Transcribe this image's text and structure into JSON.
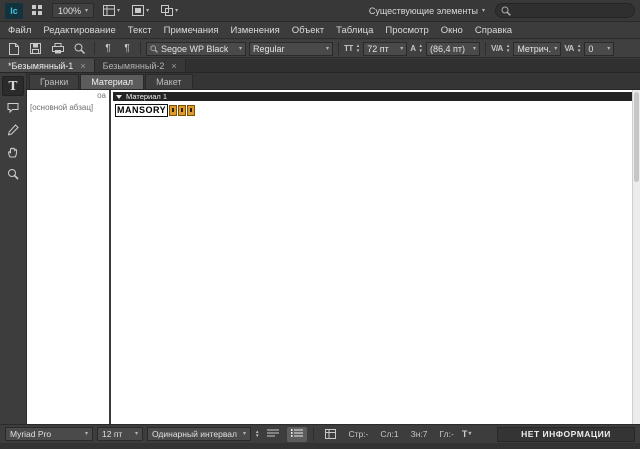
{
  "glyphs": {
    "caret": "▾",
    "close": "×",
    "pilcrow": "¶",
    "stepper_up": "▲",
    "stepper_down": "▼"
  },
  "app_bar": {
    "logo": "Ic",
    "zoom": "100%",
    "workspace": "Существующие элементы",
    "search_placeholder": ""
  },
  "menu_bar": {
    "items": [
      {
        "label": "Файл"
      },
      {
        "label": "Редактирование"
      },
      {
        "label": "Текст"
      },
      {
        "label": "Примечания"
      },
      {
        "label": "Изменения"
      },
      {
        "label": "Объект"
      },
      {
        "label": "Таблица"
      },
      {
        "label": "Просмотр"
      },
      {
        "label": "Окно"
      },
      {
        "label": "Справка"
      }
    ]
  },
  "control_bar": {
    "font": "Segoe WP Black",
    "style": "Regular",
    "size_icon": "TT",
    "size": "72 пт",
    "leading_icon": "A",
    "leading": "(86,4 пт)",
    "kerning_icon": "V/A",
    "kerning": "Метрич.",
    "tracking_icon": "VA",
    "tracking": "0"
  },
  "doc_tabs": [
    {
      "label": "*Безымянный-1"
    },
    {
      "label": "Безымянный-2"
    }
  ],
  "view_tabs": [
    {
      "label": "Гранки"
    },
    {
      "label": "Материал"
    },
    {
      "label": "Макет"
    }
  ],
  "tools": {
    "type_glyph": "T"
  },
  "galley": {
    "column_header": "оа",
    "paragraph_style": "[основной абзац]",
    "story_header": "Материал 1",
    "story_text": "MANSORY"
  },
  "status_bar": {
    "font": "Myriad Pro",
    "size": "12 пт",
    "line_spacing": "Одинарный интервал",
    "depth_icon": "T",
    "stats": [
      {
        "label": "Стр:-"
      },
      {
        "label": "Сл:1"
      },
      {
        "label": "Зн:7"
      },
      {
        "label": "Гл:-"
      }
    ],
    "info": "НЕТ ИНФОРМАЦИИ"
  }
}
